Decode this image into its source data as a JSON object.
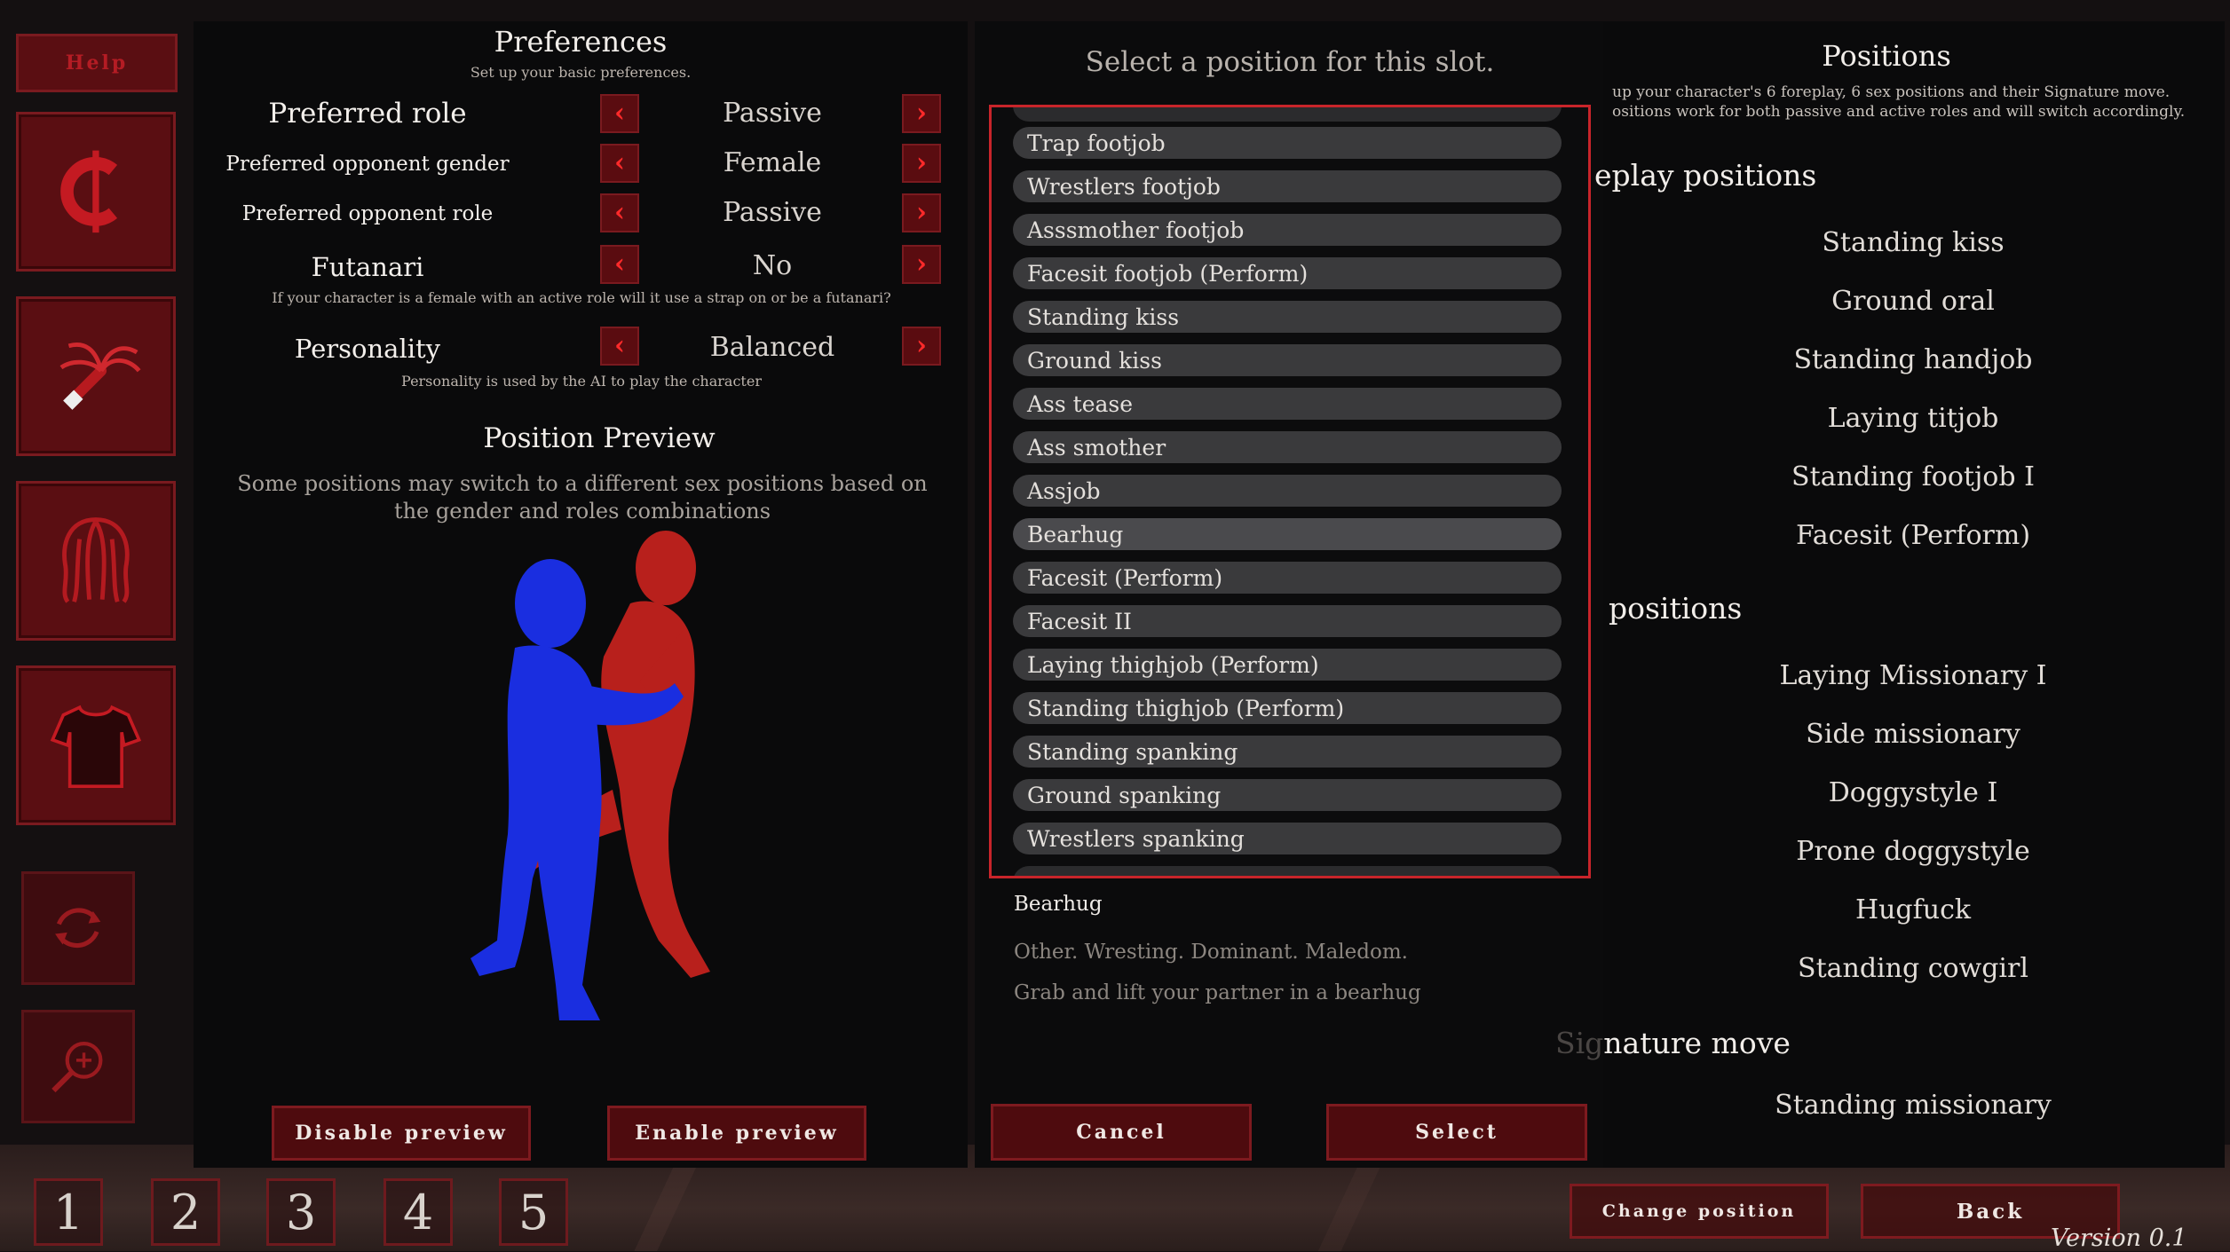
{
  "nav": {
    "help_label": "Help",
    "buttons": [
      "currency-icon",
      "whip-icon",
      "hair-icon",
      "shirt-icon"
    ],
    "small_buttons": [
      "rotate-icon",
      "zoom-icon"
    ]
  },
  "preferences": {
    "title": "Preferences",
    "subtitle": "Set up your basic preferences.",
    "rows": [
      {
        "label": "Preferred role",
        "value": "Passive"
      },
      {
        "label": "Preferred opponent gender",
        "value": "Female"
      },
      {
        "label": "Preferred opponent role",
        "value": "Passive"
      },
      {
        "label": "Futanari",
        "value": "No"
      },
      {
        "label": "Personality",
        "value": "Balanced"
      }
    ],
    "futanari_note": "If your character is a female with an active role will it use a strap on or be a futanari?",
    "personality_note": "Personality is used by the AI to play the character"
  },
  "preview": {
    "title": "Position Preview",
    "note": "Some positions may switch to a different sex positions based on the gender and roles combinations",
    "disable_label": "Disable preview",
    "enable_label": "Enable preview"
  },
  "selector": {
    "title": "Select a position for this slot.",
    "items": [
      "Trap footjob",
      "Wrestlers footjob",
      "Asssmother footjob",
      "Facesit footjob (Perform)",
      "Standing kiss",
      "Ground kiss",
      "Ass tease",
      "Ass smother",
      "Assjob",
      "Bearhug",
      "Facesit (Perform)",
      "Facesit II",
      "Laying thighjob (Perform)",
      "Standing thighjob (Perform)",
      "Standing spanking",
      "Ground spanking",
      "Wrestlers spanking"
    ],
    "selected_name": "Bearhug",
    "selected_tags": "Other. Wresting. Dominant. Maledom.",
    "selected_desc": "Grab and lift your partner in a bearhug",
    "cancel_label": "Cancel",
    "select_label": "Select"
  },
  "positions": {
    "title": "Positions",
    "desc_line1": "up your character's 6 foreplay, 6 sex positions and their Signature move.",
    "desc_line2": "ositions work for both passive and active roles and will switch accordingly.",
    "foreplay_heading": "eplay positions",
    "foreplay": [
      "Standing kiss",
      "Ground oral",
      "Standing handjob",
      "Laying titjob",
      "Standing footjob I",
      "Facesit (Perform)"
    ],
    "sex_heading": "positions",
    "sex": [
      "Laying Missionary I",
      "Side missionary",
      "Doggystyle I",
      "Prone doggystyle",
      "Hugfuck",
      "Standing cowgirl"
    ],
    "signature_heading_faded": "Sig",
    "signature_heading": "nature move",
    "signature": "Standing missionary",
    "change_label": "Change position",
    "back_label": "Back"
  },
  "footer": {
    "slots": [
      "1",
      "2",
      "3",
      "4",
      "5"
    ],
    "version": "Version 0.1"
  },
  "colors": {
    "accent": "#c8242a",
    "button": "#4e0b0e",
    "figure_a": "#1a2ee0",
    "figure_b": "#b8201c"
  }
}
